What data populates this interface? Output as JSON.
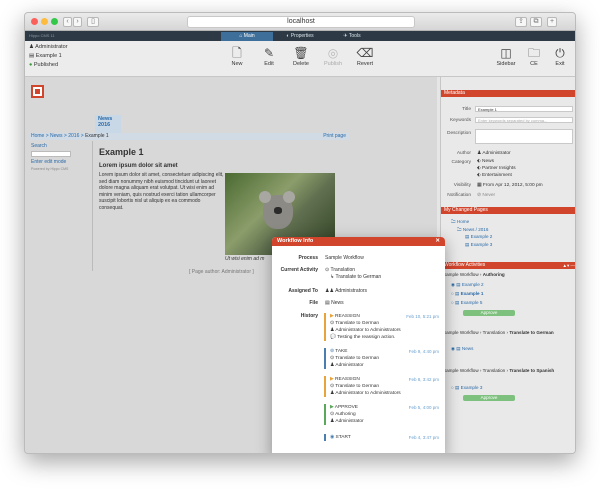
{
  "browser": {
    "url": "localhost"
  },
  "app": {
    "brand": "Hippo CMS 11",
    "tabs": {
      "main": "Main",
      "properties": "Properties",
      "tools": "Tools"
    }
  },
  "doc": {
    "user": "Administrator",
    "name": "Example 1",
    "status": "Published"
  },
  "toolbar": {
    "new": "New",
    "edit": "Edit",
    "delete": "Delete",
    "publish": "Publish",
    "revert": "Revert",
    "sidebar": "Sidebar",
    "ce": "CE",
    "exit": "Exit"
  },
  "preview": {
    "nav_label": "News",
    "nav_year": "2016",
    "breadcrumb": "Home > News > 2016 > ",
    "breadcrumb_current": "Example 1",
    "print": "Print page",
    "search": "Search",
    "edit_mode": "Enter edit mode",
    "powered": "Powered by Hippo CMS",
    "title": "Example 1",
    "subtitle": "Lorem ipsum dolor sit amet",
    "body": "Lorem ipsum dolor sit amet, consectetuer adipiscing elit, sed diam nonummy nibh euismod tincidunt ut laoreet dolore magna aliquam erat volutpat. Ut wisi enim ad minim veniam, quis nostrud exerci tation ullamcorper suscipit lobortis nisl ut aliquip ex ea commodo consequat.",
    "caption": "Ut wisi enim ad m",
    "author_line": "[ Page author: Administrator ]"
  },
  "metadata": {
    "header": "Metadata",
    "title_label": "Title",
    "title_value": "Example 1",
    "keywords_label": "Keywords",
    "keywords_placeholder": "Enter keywords separated by comma...",
    "description_label": "Description",
    "author_label": "Author",
    "author_value": "Administrator",
    "category_label": "Category",
    "categories": [
      "News",
      "Partner Insights",
      "Entertainment"
    ],
    "visibility_label": "Visibility",
    "visibility_value": "From Apr 12, 2012, 5:00 pm",
    "notification_label": "Notification",
    "notification_value": "Never"
  },
  "changed": {
    "header": "My Changed Pages",
    "home": "Home",
    "path": "News / 2016",
    "items": [
      "Example 2",
      "Example 3"
    ]
  },
  "activities": {
    "header": "Workflow Activities",
    "g1": {
      "title": "Sample Workflow",
      "task": "Authoring",
      "items": [
        "Example 2",
        "Example 1",
        "Example 5"
      ],
      "approve": "Approve"
    },
    "g2": {
      "title": "Sample Workflow",
      "sep": "Translation",
      "task": "Translate to German",
      "item": "News"
    },
    "g3": {
      "title": "Sample Workflow",
      "sep": "Translation",
      "task": "Translate to Spanish",
      "item": "Example 3",
      "approve": "Approve"
    }
  },
  "workflow": {
    "header": "Workflow Info",
    "process_label": "Process",
    "process": "Sample Workflow",
    "activity_label": "Current Activity",
    "activity": "Translation",
    "activity_sub": "Translate to German",
    "assigned_label": "Assigned To",
    "assigned": "Administrators",
    "file_label": "File",
    "file": "News",
    "history_label": "History",
    "history": [
      {
        "action": "REASSIGN",
        "date": "Feb 10, 5:21 pm",
        "lines": [
          "Translate to German",
          "Administrator to Administrators",
          "Testing the reassign action."
        ],
        "color": "#e8a33a"
      },
      {
        "action": "TAKE",
        "date": "Feb 9, 4:40 pm",
        "lines": [
          "Translate to German",
          "Administrator"
        ],
        "color": "#4a7db0"
      },
      {
        "action": "REASSIGN",
        "date": "Feb 8, 3:42 pm",
        "lines": [
          "Translate to German",
          "Administrator to Administrators"
        ],
        "color": "#e8a33a"
      },
      {
        "action": "APPROVE",
        "date": "Feb 5, 4:00 pm",
        "lines": [
          "Authoring",
          "Administrator"
        ],
        "color": "#5aa85a"
      },
      {
        "action": "START",
        "date": "Feb 4, 3:47 pm",
        "lines": [],
        "color": "#4a7db0"
      }
    ]
  }
}
